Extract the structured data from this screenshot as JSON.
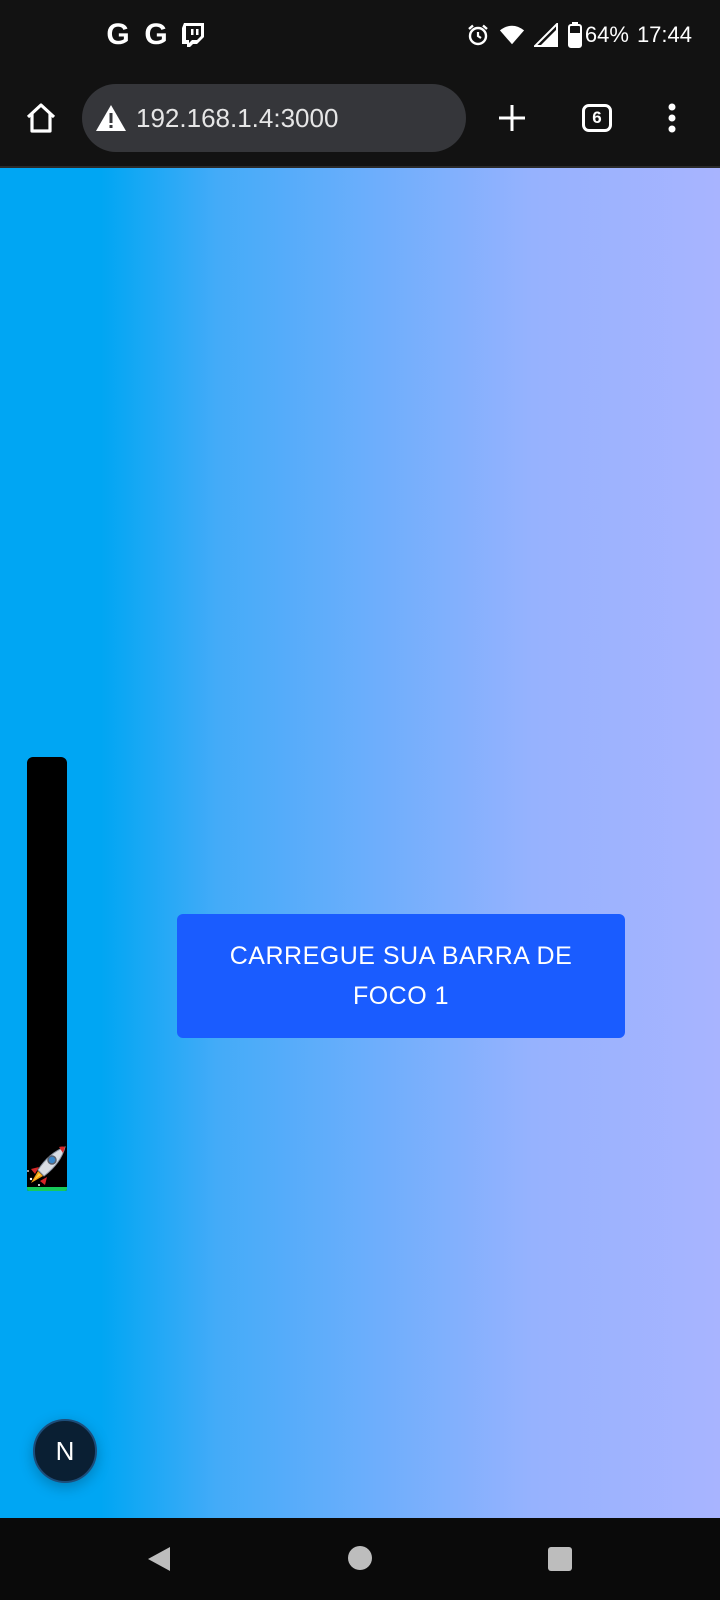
{
  "status_bar": {
    "left_icons": [
      "g-app-icon",
      "g-app-icon",
      "twitch-icon"
    ],
    "g_letter": "G",
    "battery": "64%",
    "time": "17:44"
  },
  "browser": {
    "url": "192.168.1.4:3000",
    "tab_count": "6"
  },
  "page": {
    "focus_bar": {
      "icon": "rocket-icon",
      "progress": 0.01,
      "fill_color": "#17c95a"
    },
    "charge_button_label": "CARREGUE SUA BARRA DE FOCO 1",
    "nextjs_badge_label": "N",
    "background_colors": [
      "#00a6f3",
      "#a8b4ff"
    ],
    "button_color": "#1a5cff"
  }
}
